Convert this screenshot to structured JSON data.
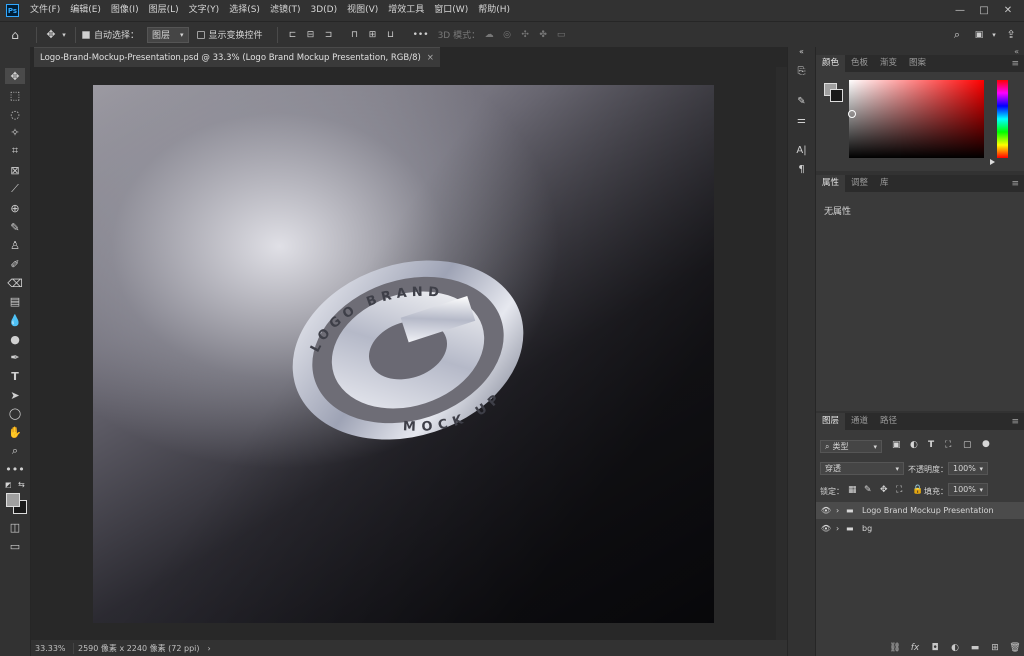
{
  "app": {
    "logo_text": "Ps"
  },
  "menu": [
    "文件(F)",
    "编辑(E)",
    "图像(I)",
    "图层(L)",
    "文字(Y)",
    "选择(S)",
    "滤镜(T)",
    "3D(D)",
    "视图(V)",
    "增效工具",
    "窗口(W)",
    "帮助(H)"
  ],
  "window_controls": {
    "minimize": "—",
    "maximize": "□",
    "close": "✕"
  },
  "options": {
    "auto_select_label": "自动选择：",
    "auto_select_value": "图层",
    "show_transform_label": "显示变换控件",
    "mode_3d_label": "3D 模式：",
    "more": "•••"
  },
  "document": {
    "tab_title": "Logo-Brand-Mockup-Presentation.psd @ 33.3% (Logo Brand Mockup Presentation, RGB/8)",
    "tab_close": "×",
    "zoom": "33.33%",
    "dimensions": "2590 像素 x 2240 像素 (72 ppi)",
    "arrow": "›"
  },
  "artwork": {
    "ring_top_text": "LOGO BRAND",
    "ring_bottom_text": "MOCK UP"
  },
  "color_panel": {
    "tabs": [
      "颜色",
      "色板",
      "渐变",
      "图案"
    ],
    "active_tab": "颜色",
    "fg_color": "#a0a0a0",
    "bg_color": "#1a1a1a"
  },
  "properties_panel": {
    "tabs": [
      "属性",
      "调整",
      "库"
    ],
    "content": "无属性"
  },
  "layers_panel": {
    "tabs": [
      "图层",
      "通道",
      "路径"
    ],
    "filter_label": "类型",
    "blend_mode": "穿透",
    "opacity_label": "不透明度：",
    "opacity_value": "100%",
    "lock_label": "锁定：",
    "fill_label": "填充：",
    "fill_value": "100%",
    "layers": [
      {
        "name": "Logo Brand Mockup Presentation",
        "selected": true
      },
      {
        "name": "bg",
        "selected": false
      }
    ]
  },
  "panel_collapse": "«",
  "panel_menu": "≡"
}
